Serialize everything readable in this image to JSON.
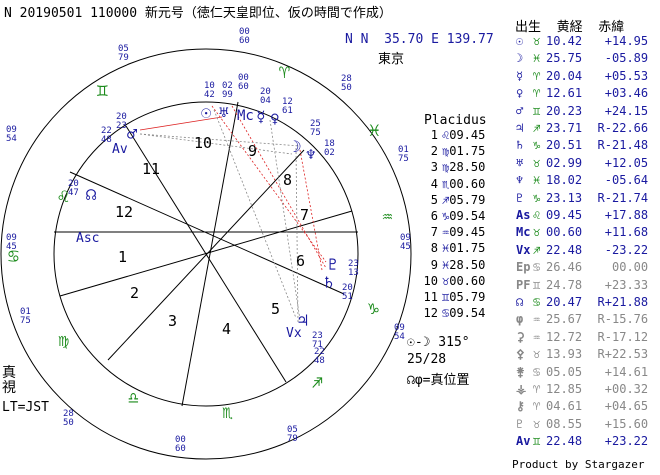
{
  "header": {
    "title": "N 20190501 110000 新元号（徳仁天皇即位、仮の時間で作成）",
    "coords": "N N  35.70 E 139.77",
    "place": "東京"
  },
  "colors": {
    "blue": "#1a1aa0",
    "green": "#1a8a1a",
    "red": "#d22",
    "gray": "#888888"
  },
  "wheel": {
    "house_numbers": [
      "1",
      "2",
      "3",
      "4",
      "5",
      "6",
      "7",
      "8",
      "9",
      "10",
      "11",
      "12"
    ],
    "sign_ring": [
      {
        "glyph": "♈",
        "name": "aries-glyph"
      },
      {
        "glyph": "♓",
        "name": "pisces-glyph"
      },
      {
        "glyph": "♒",
        "name": "aquarius-glyph"
      },
      {
        "glyph": "♑",
        "name": "capricorn-glyph"
      },
      {
        "glyph": "♐",
        "name": "sagittarius-glyph"
      },
      {
        "glyph": "♏",
        "name": "scorpio-glyph"
      },
      {
        "glyph": "♎",
        "name": "libra-glyph"
      },
      {
        "glyph": "♍",
        "name": "virgo-glyph"
      },
      {
        "glyph": "♌",
        "name": "leo-glyph"
      },
      {
        "glyph": "♋",
        "name": "cancer-glyph"
      },
      {
        "glyph": "♊",
        "name": "gemini-glyph"
      }
    ],
    "cusp_labels": [
      {
        "id": "mc-top",
        "lines": [
          "00",
          "60"
        ]
      },
      {
        "id": "c11-top",
        "lines": [
          "05",
          "79"
        ]
      },
      {
        "id": "c9-top",
        "lines": [
          "28",
          "50"
        ]
      },
      {
        "id": "c12-left",
        "lines": [
          "09",
          "54"
        ]
      },
      {
        "id": "c8-right",
        "lines": [
          "01",
          "75"
        ]
      },
      {
        "id": "asc-left",
        "lines": [
          "09",
          "45"
        ]
      },
      {
        "id": "dsc-right",
        "lines": [
          "09",
          "45"
        ]
      },
      {
        "id": "c2-left",
        "lines": [
          "01",
          "75"
        ]
      },
      {
        "id": "c6-right",
        "lines": [
          "09",
          "54"
        ]
      },
      {
        "id": "ic-bottom",
        "lines": [
          "00",
          "60"
        ]
      },
      {
        "id": "c5-bottom",
        "lines": [
          "28",
          "50"
        ]
      },
      {
        "id": "c3-bottom",
        "lines": [
          "05",
          "79"
        ]
      }
    ],
    "planets": [
      {
        "id": "sun",
        "glyph": "☉",
        "deg": [
          "10",
          "42"
        ]
      },
      {
        "id": "uranus",
        "glyph": "♅",
        "deg": [
          "02",
          "99"
        ]
      },
      {
        "id": "mc",
        "glyph": "Mc",
        "deg": [
          "00",
          "60"
        ]
      },
      {
        "id": "mercury",
        "glyph": "☿",
        "deg": [
          "20",
          "04"
        ]
      },
      {
        "id": "venus",
        "glyph": "♀",
        "deg": [
          "12",
          "61"
        ]
      },
      {
        "id": "moon",
        "glyph": "☽",
        "deg": [
          "25",
          "75"
        ]
      },
      {
        "id": "neptune",
        "glyph": "♆",
        "deg": [
          "18",
          "02"
        ]
      },
      {
        "id": "mars",
        "glyph": "♂",
        "deg": [
          "20",
          "23"
        ]
      },
      {
        "id": "av",
        "glyph": "Av",
        "deg": [
          "22",
          "48"
        ]
      },
      {
        "id": "node",
        "glyph": "☊",
        "deg": [
          "20",
          "47"
        ]
      },
      {
        "id": "asc",
        "glyph": "Asc",
        "deg": []
      },
      {
        "id": "pluto",
        "glyph": "♇",
        "deg": [
          "23",
          "13"
        ]
      },
      {
        "id": "saturn",
        "glyph": "♄",
        "deg": [
          "20",
          "51"
        ]
      },
      {
        "id": "jupiter",
        "glyph": "♃",
        "deg": [
          "23",
          "71"
        ]
      },
      {
        "id": "vertex",
        "glyph": "Vx",
        "deg": [
          "22",
          "48"
        ]
      }
    ]
  },
  "placidus": {
    "title": "Placidus",
    "rows": [
      {
        "n": "1",
        "sign": "♌",
        "deg": "09.45"
      },
      {
        "n": "2",
        "sign": "♍",
        "deg": "01.75"
      },
      {
        "n": "3",
        "sign": "♍",
        "deg": "28.50"
      },
      {
        "n": "4",
        "sign": "♏",
        "deg": "00.60"
      },
      {
        "n": "5",
        "sign": "♐",
        "deg": "05.79"
      },
      {
        "n": "6",
        "sign": "♑",
        "deg": "09.54"
      },
      {
        "n": "7",
        "sign": "♒",
        "deg": "09.45"
      },
      {
        "n": "8",
        "sign": "♓",
        "deg": "01.75"
      },
      {
        "n": "9",
        "sign": "♓",
        "deg": "28.50"
      },
      {
        "n": "10",
        "sign": "♉",
        "deg": "00.60"
      },
      {
        "n": "11",
        "sign": "♊",
        "deg": "05.79"
      },
      {
        "n": "12",
        "sign": "♋",
        "deg": "09.54"
      }
    ]
  },
  "positions": {
    "header": "出生  黄経  赤緯",
    "rows": [
      {
        "sym": "☉",
        "sign": "♉",
        "lon": "10.42",
        "dec": "+14.95",
        "dim": false
      },
      {
        "sym": "☽",
        "sign": "♓",
        "lon": "25.75",
        "dec": "-05.89",
        "dim": false
      },
      {
        "sym": "☿",
        "sign": "♈",
        "lon": "20.04",
        "dec": "+05.53",
        "dim": false
      },
      {
        "sym": "♀",
        "sign": "♈",
        "lon": "12.61",
        "dec": "+03.46",
        "dim": false
      },
      {
        "sym": "♂",
        "sign": "♊",
        "lon": "20.23",
        "dec": "+24.15",
        "dim": false
      },
      {
        "sym": "♃",
        "sign": "♐",
        "lon": "23.71",
        "dec": "R-22.66",
        "dim": false
      },
      {
        "sym": "♄",
        "sign": "♑",
        "lon": "20.51",
        "dec": "R-21.48",
        "dim": false
      },
      {
        "sym": "♅",
        "sign": "♉",
        "lon": "02.99",
        "dec": "+12.05",
        "dim": false
      },
      {
        "sym": "♆",
        "sign": "♓",
        "lon": "18.02",
        "dec": "-05.64",
        "dim": false
      },
      {
        "sym": "♇",
        "sign": "♑",
        "lon": "23.13",
        "dec": "R-21.74",
        "dim": false
      },
      {
        "sym": "As",
        "sign": "♌",
        "lon": "09.45",
        "dec": "+17.88",
        "dim": false
      },
      {
        "sym": "Mc",
        "sign": "♉",
        "lon": "00.60",
        "dec": "+11.68",
        "dim": false
      },
      {
        "sym": "Vx",
        "sign": "♐",
        "lon": "22.48",
        "dec": "-23.22",
        "dim": false
      },
      {
        "sym": "Ep",
        "sign": "♋",
        "lon": "26.46",
        "dec": "00.00",
        "dim": true
      },
      {
        "sym": "PF",
        "sign": "♊",
        "lon": "24.78",
        "dec": "+23.33",
        "dim": true
      },
      {
        "sym": "☊",
        "sign": "♋",
        "lon": "20.47",
        "dec": "R+21.88",
        "dim": false
      },
      {
        "sym": "φ",
        "sign": "♒",
        "lon": "25.67",
        "dec": "R-15.76",
        "dim": true
      },
      {
        "sym": "⚳",
        "sign": "♒",
        "lon": "12.72",
        "dec": "R-17.12",
        "dim": true
      },
      {
        "sym": "⚴",
        "sign": "♉",
        "lon": "13.93",
        "dec": "R+22.53",
        "dim": true
      },
      {
        "sym": "⚵",
        "sign": "♋",
        "lon": "05.05",
        "dec": "+14.61",
        "dim": true
      },
      {
        "sym": "⚶",
        "sign": "♈",
        "lon": "12.85",
        "dec": "+00.32",
        "dim": true
      },
      {
        "sym": "⚷",
        "sign": "♈",
        "lon": "04.61",
        "dec": "+04.65",
        "dim": true
      },
      {
        "sym": "♇",
        "sign": "♉",
        "lon": "08.55",
        "dec": "+15.60",
        "dim": true
      },
      {
        "sym": "Av",
        "sign": "♊",
        "lon": "22.48",
        "dec": "+23.22",
        "dim": false
      }
    ]
  },
  "phase": {
    "line1": "☉-☽ 315°",
    "line2": "25/28",
    "line3": "☊φ=真位置"
  },
  "footer": {
    "mode": "真\n視",
    "tz": "LT=JST",
    "credit": "Product by Stargazer"
  }
}
